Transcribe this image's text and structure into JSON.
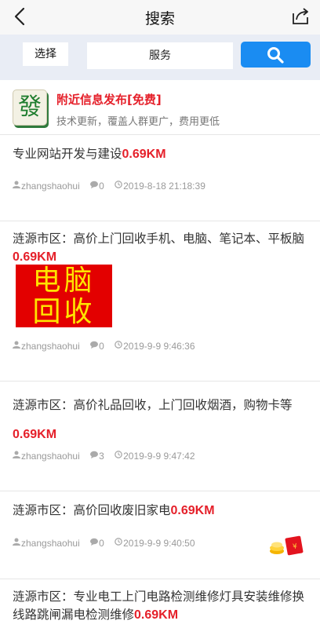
{
  "nav": {
    "title": "搜索",
    "back_icon": "back-arrow-icon",
    "share_icon": "share-icon"
  },
  "search": {
    "select_label": "选择",
    "keyword": "服务",
    "search_icon": "search-icon",
    "button_color": "#1a8cf2"
  },
  "ad": {
    "tile_char": "發",
    "title": "附近信息发布[免费]",
    "subtitle": "技术更新，覆盖人群更广，费用更低",
    "accent": "#e5202a"
  },
  "posts": [
    {
      "title": "专业网站开发与建设",
      "distance": "0.69KM",
      "author": "zhangshaohui",
      "comments": "0",
      "time": "2019-8-18 21:18:39"
    },
    {
      "title": "涟源市区：高价上门回收手机、电脑、笔记本、平板脑",
      "distance": "0.69KM",
      "image_text_1": "电脑",
      "image_text_2": "回收",
      "author": "zhangshaohui",
      "comments": "0",
      "time": "2019-9-9 9:46:36"
    },
    {
      "title": "涟源市区：高价礼品回收，上门回收烟酒，购物卡等",
      "distance": "0.69KM",
      "author": "zhangshaohui",
      "comments": "3",
      "time": "2019-9-9 9:47:42"
    },
    {
      "title": "涟源市区：高价回收废旧家电",
      "distance": "0.69KM",
      "author": "zhangshaohui",
      "comments": "0",
      "time": "2019-9-9 9:40:50"
    },
    {
      "title": "涟源市区：专业电工上门电路检测维修灯具安装维修换线路跳闸漏电检测维修",
      "distance": "0.69KM"
    }
  ],
  "red_packet_icon": "red-packet-icon"
}
